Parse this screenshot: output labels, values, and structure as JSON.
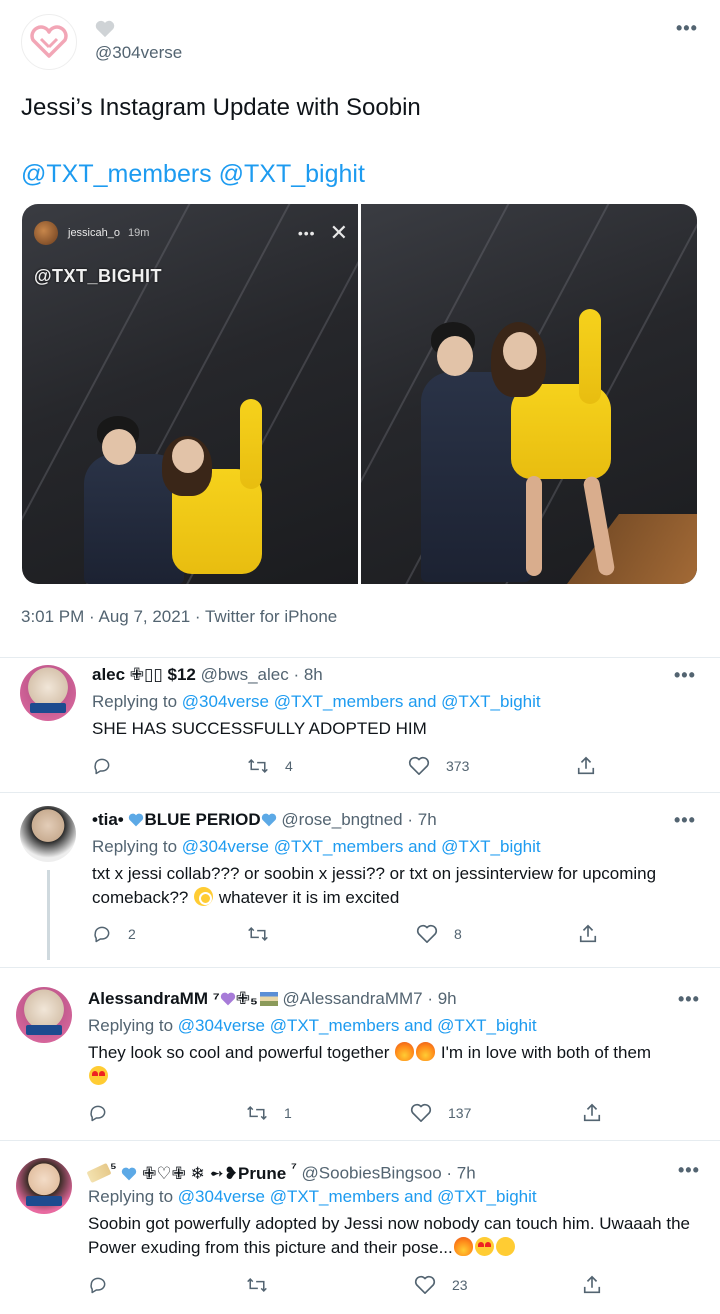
{
  "main_tweet": {
    "handle": "@304verse",
    "text": "Jessi’s Instagram Update with Soobin",
    "mentions": "@TXT_members @TXT_bighit",
    "story_user": "jessicah_o",
    "story_time": "19m",
    "story_tag": "@TXT_BIGHIT",
    "meta": "3:01 PM · Aug 7, 2021 · Twitter for iPhone"
  },
  "replies": [
    {
      "name": "alec ✙▯▯ $12",
      "handle": "@bws_alec · 8h",
      "replying_prefix": "Replying to ",
      "replying_to": "@304verse @TXT_members and @TXT_bighit",
      "body": "SHE HAS SUCCESSFULLY ADOPTED HIM",
      "reply_count": "",
      "retweet_count": "4",
      "like_count": "373"
    },
    {
      "name_prefix": "•tia•",
      "name_suffix": "BLUE PERIOD",
      "handle": "@rose_bngtned · 7h",
      "replying_prefix": "Replying to ",
      "replying_to": "@304verse @TXT_members and @TXT_bighit",
      "body": "txt x jessi collab??? or soobin x jessi?? or txt on jessinterview for upcoming comeback?? ",
      "body_suffix": " whatever it is im excited",
      "reply_count": "2",
      "retweet_count": "",
      "like_count": "8"
    },
    {
      "name": "AlessandraMM",
      "name_badges": "⁷",
      "name_badges2": "✙₅",
      "handle": "@AlessandraMM7 · 9h",
      "replying_prefix": "Replying to ",
      "replying_to": "@304verse @TXT_members and @TXT_bighit",
      "body": "They look so cool and powerful together ",
      "body_suffix": " I'm in love with both of them ",
      "reply_count": "",
      "retweet_count": "1",
      "like_count": "137"
    },
    {
      "name_prefix": "⁵",
      "name": "✙♡✙ ❄ ➻❥Prune",
      "name_sup": "⁷",
      "handle": "@SoobiesBingsoo · 7h",
      "replying_prefix": "Replying to ",
      "replying_to": "@304verse @TXT_members and @TXT_bighit",
      "body": "Soobin got powerfully adopted by Jessi now nobody can touch him. Uwaaah the Power exuding from this picture and their pose...",
      "reply_count": "",
      "retweet_count": "",
      "like_count": "23"
    }
  ],
  "colors": {
    "accent_blue": "#1d9bf0",
    "muted": "#536471",
    "text": "#0f1419"
  }
}
